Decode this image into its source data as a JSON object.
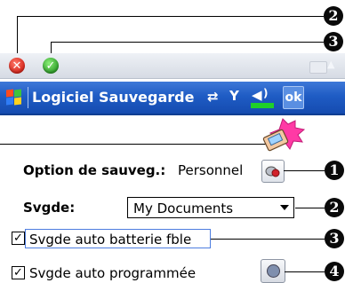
{
  "callouts": {
    "top_close": "2",
    "top_ok": "3",
    "option": "1",
    "svgde": "2",
    "battery": "3",
    "scheduled": "4"
  },
  "topbar": {
    "close_glyph": "✕",
    "ok_glyph": "✓",
    "up_arrow_glyph": "▲"
  },
  "navbar": {
    "title": "Logiciel Sauvegarde",
    "ok_label": "ok",
    "icons": [
      "connectivity-icon",
      "signal-icon",
      "volume-icon"
    ]
  },
  "form": {
    "option_label": "Option de sauveg.:",
    "option_value": "Personnel",
    "svgde_label": "Svgde:",
    "svgde_value": "My Documents",
    "battery_label": "Svgde auto batterie fble",
    "battery_checked": true,
    "scheduled_label": "Svgde auto programmée",
    "scheduled_checked": true,
    "check_glyph": "✓"
  },
  "colors": {
    "title_bar": "#1f5cc4",
    "close": "#d6261c",
    "ok_green": "#2f9e2a",
    "volume_green": "#1fcf2a"
  }
}
